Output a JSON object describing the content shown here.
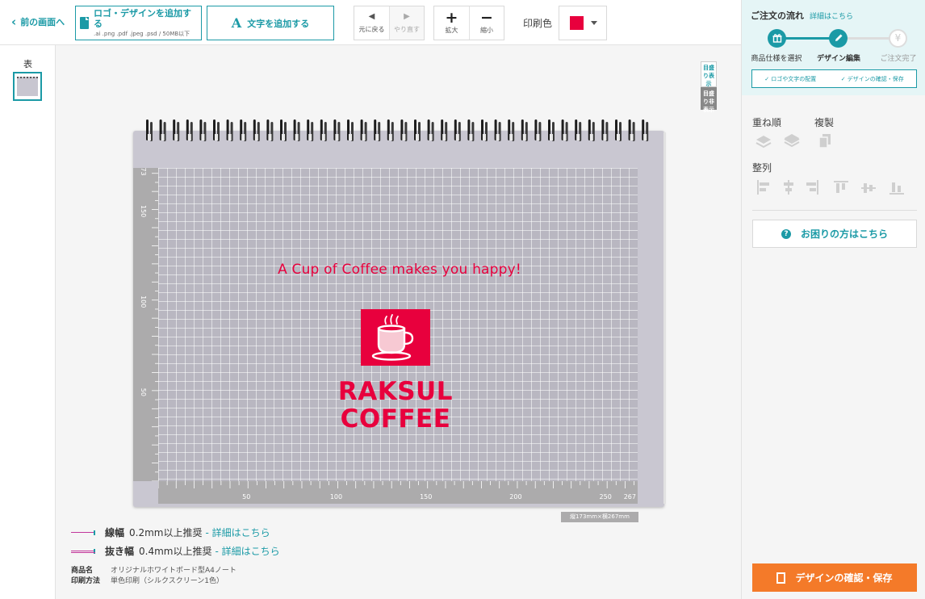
{
  "toolbar": {
    "back_label": "前の画面へ",
    "logo_button_label": "ロゴ・デザインを追加する",
    "logo_button_formats": ".ai .png .pdf .jpeg .psd / 50MB以下",
    "text_button_label": "文字を追加する",
    "text_button_icon": "A",
    "undo_label": "元に戻る",
    "redo_label": "やり直す",
    "zoom_in_label": "拡大",
    "zoom_out_label": "縮小",
    "print_color_label": "印刷色",
    "print_color_value": "#e8003d"
  },
  "pages": {
    "front_label": "表"
  },
  "canvas": {
    "guide_on_label": "目盛り表示",
    "guide_off_label": "目盛り非表示",
    "size_label": "縦173mm×横267mm",
    "ruler_left_ticks": [
      "173",
      "150",
      "100",
      "50"
    ],
    "ruler_bottom_ticks": [
      "50",
      "100",
      "150",
      "200",
      "250",
      "267"
    ],
    "design": {
      "tagline": "A Cup of Coffee makes you happy!",
      "brand_line1": "RAKSUL",
      "brand_line2": "COFFEE",
      "color": "#e8003d"
    }
  },
  "notes": {
    "line_width_label": "線幅",
    "line_width_value": "0.2mm以上推奨",
    "cutout_label": "抜き幅",
    "cutout_value": "0.4mm以上推奨",
    "details_link": "- 詳細はこちら"
  },
  "product": {
    "name_key": "商品名",
    "name_value": "オリジナルホワイトボード型A4ノート",
    "method_key": "印刷方法",
    "method_value": "単色印刷（シルクスクリーン1色）"
  },
  "order_flow": {
    "title": "ご注文の流れ",
    "details_link": "詳細はこちら",
    "steps": [
      {
        "label": "商品仕様を選択",
        "icon": "gift-icon",
        "state": "done"
      },
      {
        "label": "デザイン編集",
        "icon": "pencil-icon",
        "state": "active"
      },
      {
        "label": "ご注文完了",
        "icon": "yen-icon",
        "state": "todo"
      }
    ],
    "check1": "✓ ロゴや文字の配置",
    "check2": "✓ デザインの確認・保存"
  },
  "panel": {
    "order_label": "重ね順",
    "duplicate_label": "複製",
    "align_label": "整列",
    "help_label": "お困りの方はこちら",
    "confirm_label": "デザインの確認・保存"
  }
}
